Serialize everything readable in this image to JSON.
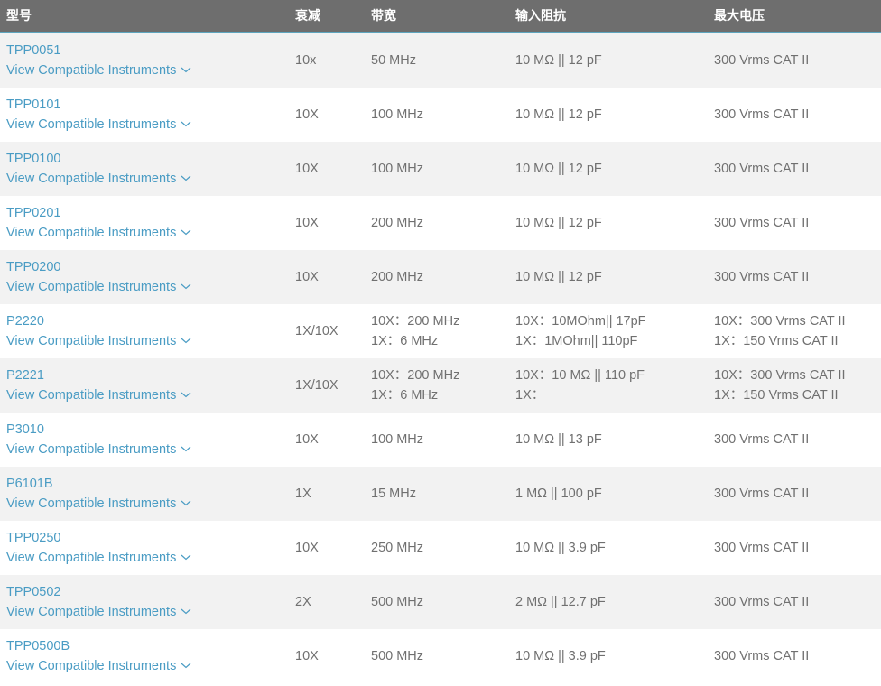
{
  "headers": {
    "model": "型号",
    "attenuation": "衰减",
    "bandwidth": "带宽",
    "input_impedance": "输入阻抗",
    "max_voltage": "最大电压"
  },
  "compat_label": "View Compatible Instruments",
  "icons": {
    "expand": "chevron-down-icon"
  },
  "colors": {
    "header_bg": "#6e6e6e",
    "header_border": "#5ea6bf",
    "link": "#4a9cc4",
    "row_alt": "#f2f2f2"
  },
  "rows": [
    {
      "model": "TPP0051",
      "attenuation": "10x",
      "bandwidth": [
        "50 MHz"
      ],
      "impedance": [
        "10 MΩ || 12 pF"
      ],
      "voltage": [
        "300 Vrms CAT II"
      ]
    },
    {
      "model": "TPP0101",
      "attenuation": "10X",
      "bandwidth": [
        "100 MHz"
      ],
      "impedance": [
        "10 MΩ || 12 pF"
      ],
      "voltage": [
        "300 Vrms CAT II"
      ]
    },
    {
      "model": "TPP0100",
      "attenuation": "10X",
      "bandwidth": [
        "100 MHz"
      ],
      "impedance": [
        "10 MΩ || 12 pF"
      ],
      "voltage": [
        "300 Vrms CAT II"
      ]
    },
    {
      "model": "TPP0201",
      "attenuation": "10X",
      "bandwidth": [
        "200 MHz"
      ],
      "impedance": [
        "10 MΩ || 12 pF"
      ],
      "voltage": [
        "300 Vrms CAT II"
      ]
    },
    {
      "model": "TPP0200",
      "attenuation": "10X",
      "bandwidth": [
        "200 MHz"
      ],
      "impedance": [
        "10 MΩ || 12 pF"
      ],
      "voltage": [
        "300 Vrms CAT II"
      ]
    },
    {
      "model": "P2220",
      "attenuation": "1X/10X",
      "bandwidth": [
        "10X：200 MHz",
        "1X：6 MHz"
      ],
      "impedance": [
        "10X：10MOhm|| 17pF",
        "1X：1MOhm|| 110pF"
      ],
      "voltage": [
        "10X：300 Vrms CAT II",
        "1X：150 Vrms CAT II"
      ]
    },
    {
      "model": "P2221",
      "attenuation": "1X/10X",
      "bandwidth": [
        "10X：200 MHz",
        "1X：6 MHz"
      ],
      "impedance": [
        "10X：10 MΩ || 110 pF",
        "1X："
      ],
      "voltage": [
        "10X：300 Vrms CAT II",
        "1X：150 Vrms CAT II"
      ]
    },
    {
      "model": "P3010",
      "attenuation": "10X",
      "bandwidth": [
        "100 MHz"
      ],
      "impedance": [
        "10 MΩ || 13 pF"
      ],
      "voltage": [
        "300 Vrms CAT II"
      ]
    },
    {
      "model": "P6101B",
      "attenuation": "1X",
      "bandwidth": [
        "15 MHz"
      ],
      "impedance": [
        "1 MΩ || 100 pF"
      ],
      "voltage": [
        "300 Vrms CAT II"
      ]
    },
    {
      "model": "TPP0250",
      "attenuation": "10X",
      "bandwidth": [
        "250 MHz"
      ],
      "impedance": [
        "10 MΩ || 3.9 pF"
      ],
      "voltage": [
        "300 Vrms CAT II"
      ]
    },
    {
      "model": "TPP0502",
      "attenuation": "2X",
      "bandwidth": [
        "500 MHz"
      ],
      "impedance": [
        "2 MΩ || 12.7 pF"
      ],
      "voltage": [
        "300 Vrms CAT II"
      ]
    },
    {
      "model": "TPP0500B",
      "attenuation": "10X",
      "bandwidth": [
        "500 MHz"
      ],
      "impedance": [
        "10 MΩ || 3.9 pF"
      ],
      "voltage": [
        "300 Vrms CAT II"
      ]
    }
  ]
}
